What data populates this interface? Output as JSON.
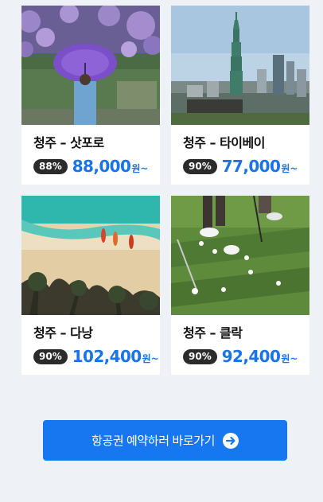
{
  "cards": [
    {
      "destination": "청주 – 삿포로",
      "discount": "88%",
      "price": "88,000",
      "unit": "원~",
      "image": "wisteria-umbrella-photo"
    },
    {
      "destination": "청주 – 타이베이",
      "discount": "90%",
      "price": "77,000",
      "unit": "원~",
      "image": "taipei-skyline-photo"
    },
    {
      "destination": "청주 – 다낭",
      "discount": "90%",
      "price": "102,400",
      "unit": "원~",
      "image": "beach-palms-photo"
    },
    {
      "destination": "청주 – 클락",
      "discount": "90%",
      "price": "92,400",
      "unit": "원~",
      "image": "golf-course-photo"
    }
  ],
  "cta": {
    "label": "항공권 예약하러 바로가기",
    "icon": "arrow-right-circle-icon"
  },
  "colors": {
    "accent": "#1a73e8",
    "button": "#1677f0",
    "badge": "#2b2b2b",
    "background": "#eef2f7"
  }
}
